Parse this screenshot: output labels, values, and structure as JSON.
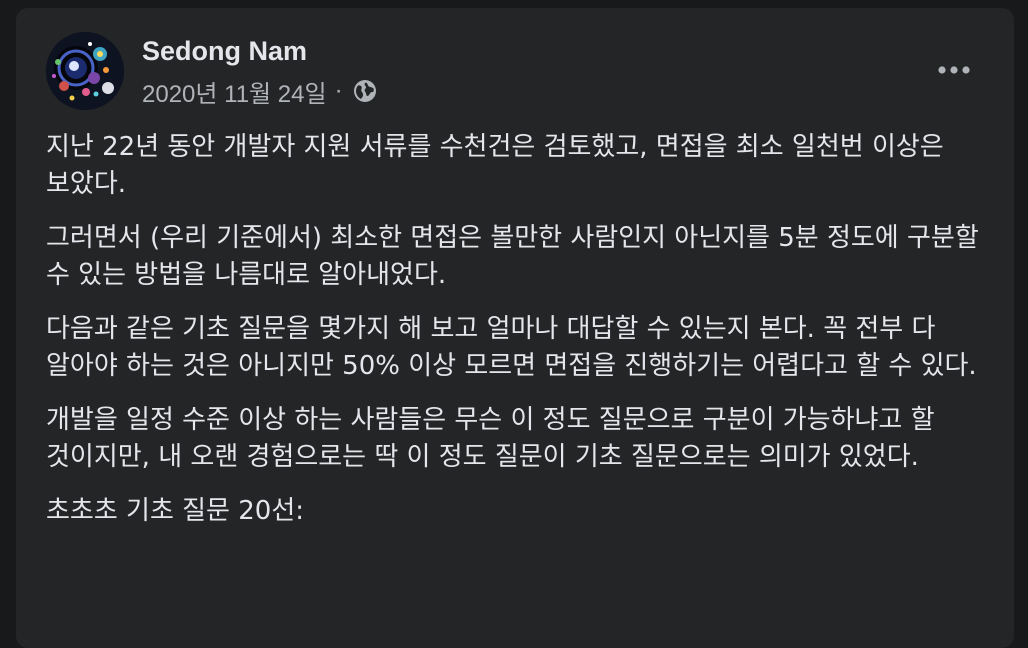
{
  "post": {
    "author": "Sedong Nam",
    "date": "2020년 11월 24일",
    "separator": "·",
    "privacy_icon": "globe-icon",
    "more_icon": "more-horizontal-icon",
    "paragraphs": [
      "지난 22년 동안 개발자 지원 서류를 수천건은 검토했고, 면접을 최소 일천번 이상은 보았다.",
      "그러면서 (우리 기준에서) 최소한 면접은 볼만한 사람인지 아닌지를 5분 정도에 구분할 수 있는 방법을 나름대로 알아내었다.",
      "다음과 같은 기초 질문을 몇가지 해 보고 얼마나 대답할 수 있는지 본다. 꼭 전부 다 알아야 하는 것은 아니지만 50% 이상 모르면 면접을 진행하기는 어렵다고 할 수 있다.",
      "개발을 일정 수준 이상 하는 사람들은 무슨 이 정도 질문으로 구분이 가능하냐고 할 것이지만, 내 오랜 경험으로는 딱 이 정도 질문이 기초 질문으로는 의미가 있었다.",
      "초초초 기초 질문 20선:"
    ]
  },
  "colors": {
    "page_background": "#18191a",
    "card_background": "#242526",
    "primary_text": "#e4e6eb",
    "secondary_text": "#b0b3b8"
  }
}
